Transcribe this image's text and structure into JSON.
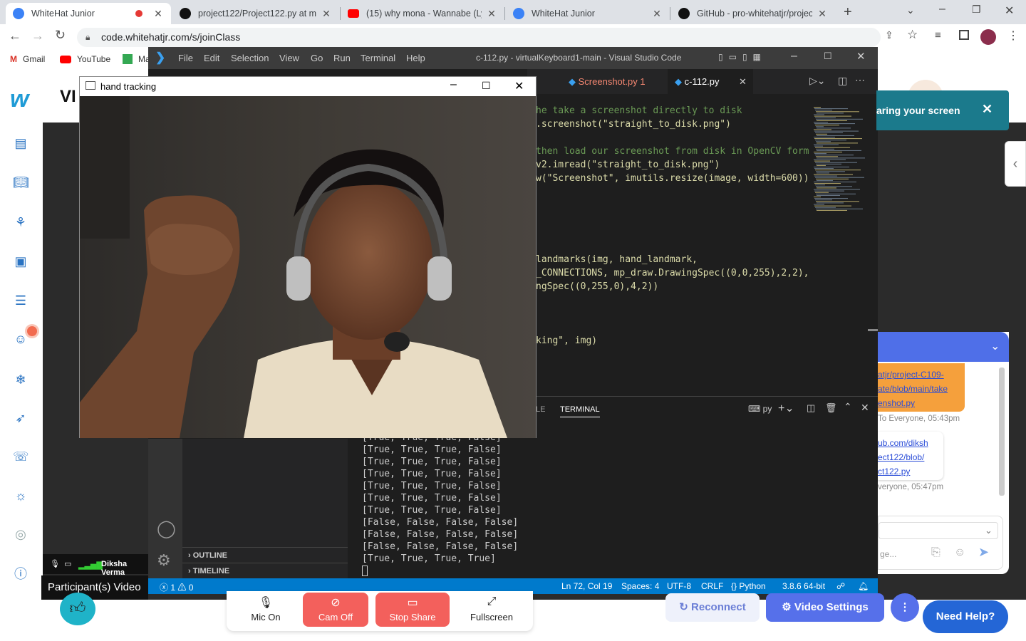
{
  "browser": {
    "tabs": [
      {
        "title": "WhiteHat Junior",
        "active": true,
        "fav_color": "#3b82f6"
      },
      {
        "title": "project122/Project122.py at ma",
        "fav_color": "#111111"
      },
      {
        "title": "(15) why mona - Wannabe (Lyric",
        "fav_color": "#ff0000"
      },
      {
        "title": "WhiteHat Junior",
        "fav_color": "#3b82f6"
      },
      {
        "title": "GitHub - pro-whitehatjr/project",
        "fav_color": "#111111"
      }
    ],
    "url": "code.whitehatjr.com/s/joinClass",
    "bookmarks": [
      "Gmail",
      "YouTube",
      "Ma"
    ]
  },
  "page": {
    "heading_fragment": "VI",
    "participant_name": "Diksha Verma",
    "participants_video_label": "Participant(s) Video",
    "sharing_banner": "aring your screen",
    "chat": {
      "msg1_link": [
        "atjr/project-C109-",
        "ate/blob/main/take",
        "enshot.py"
      ],
      "msg1_meta": "To Everyone, 05:43pm",
      "msg2_link": [
        "ub.com/diksh",
        "ect122/blob/",
        "ct122.py"
      ],
      "msg2_meta": "veryone, 05:47pm",
      "input_placeholder": "ge..."
    },
    "controls": {
      "mic": "Mic On",
      "cam": "Cam Off",
      "share": "Stop Share",
      "fullscreen": "Fullscreen"
    },
    "reconnect": "Reconnect",
    "video_settings": "Video Settings",
    "need_help": "Need Help?"
  },
  "vscode": {
    "menu": [
      "File",
      "Edit",
      "Selection",
      "View",
      "Go",
      "Run",
      "Terminal",
      "Help"
    ],
    "title": "c-112.py - virtualKeyboard1-main - Visual Studio Code",
    "tabs": [
      {
        "label": "Screenshot.py 1",
        "color": "#f48771"
      },
      {
        "label": "c-112.py",
        "color": "#ffffff"
      }
    ],
    "code_lines": [
      "he take a screenshot directly to disk",
      ".screenshot(\"straight_to_disk.png\")",
      "",
      "then load our screenshot from disk in OpenCV forma",
      "v2.imread(\"straight_to_disk.png\")",
      "w(\"Screenshot\", imutils.resize(image, width=600))",
      "",
      "",
      "",
      "",
      "",
      "landmarks(img, hand_landmark,",
      "_CONNECTIONS, mp_draw.DrawingSpec((0,0,255),2,2),",
      "ngSpec((0,255,0),4,2))",
      "",
      "",
      "",
      "king\", img)"
    ],
    "panel_tab_partial": "LE",
    "panel_tab": "TERMINAL",
    "terminal_shell": "py",
    "terminal_lines": [
      "[True, True, True, False]",
      "[True, True, True, False]",
      "[True, True, True, False]",
      "[True, True, True, False]",
      "[True, True, True, False]",
      "[True, True, True, False]",
      "[True, True, True, False]",
      "[False, False, False, False]",
      "[False, False, False, False]",
      "[False, False, False, False]",
      "[True, True, True, True]"
    ],
    "sidebar": [
      "OUTLINE",
      "TIMELINE"
    ],
    "status": {
      "errors": "1",
      "warnings": "0",
      "position": "Ln 72, Col 19",
      "spaces": "Spaces: 4",
      "encoding": "UTF-8",
      "eol": "CRLF",
      "language": "Python",
      "interpreter": "3.8.6 64-bit"
    }
  },
  "opencv_window": {
    "title": "hand tracking"
  }
}
